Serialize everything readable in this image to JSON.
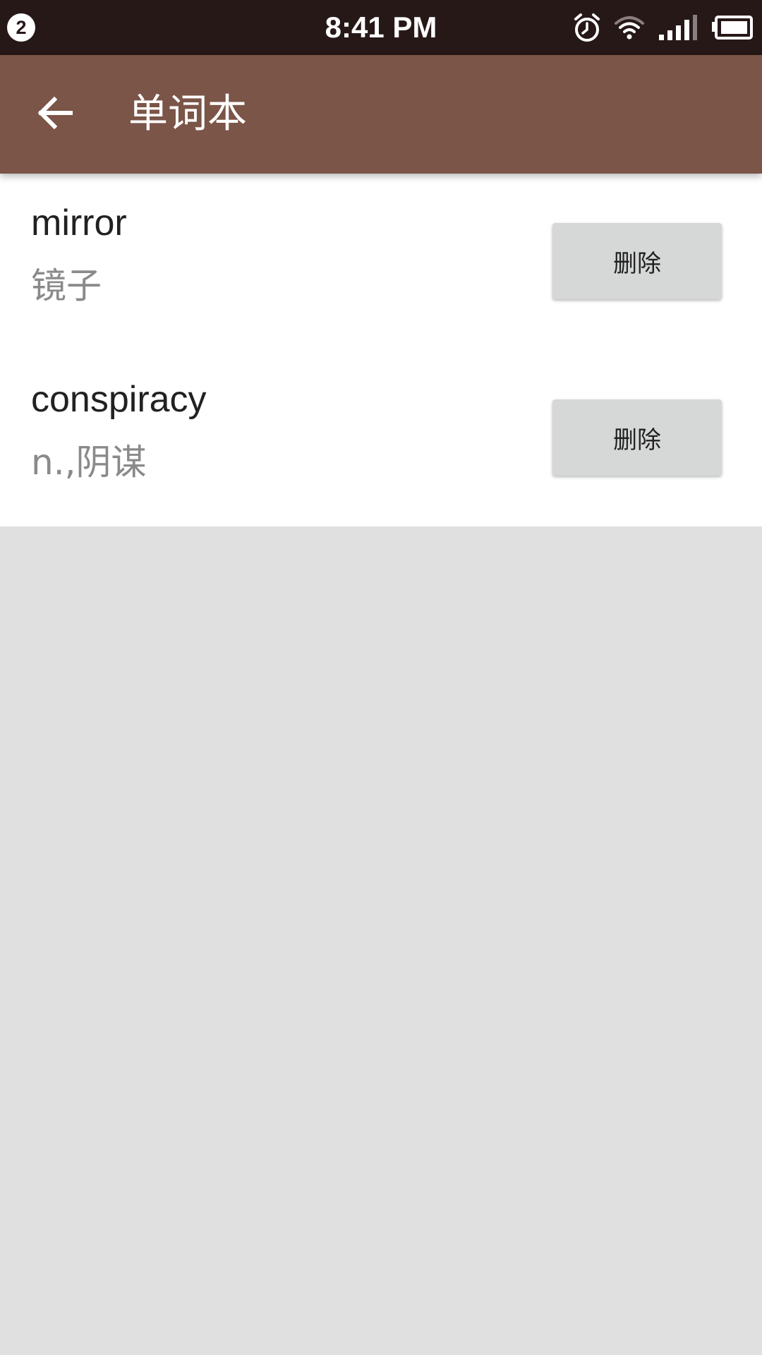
{
  "status_bar": {
    "notification_count": "2",
    "time": "8:41 PM",
    "icons": [
      "alarm-icon",
      "wifi-icon",
      "signal-icon",
      "battery-icon"
    ]
  },
  "app_bar": {
    "title": "单词本",
    "back_icon": "arrow-left-icon",
    "background_color": "#7b5548"
  },
  "words": [
    {
      "word": "mirror",
      "meaning": "镜子",
      "delete_label": "删除"
    },
    {
      "word": "conspiracy",
      "meaning": "n.,阴谋",
      "delete_label": "删除"
    }
  ],
  "colors": {
    "status_bar": "#271818",
    "button": "#d6d7d7",
    "empty_area": "#e0e0e0"
  }
}
